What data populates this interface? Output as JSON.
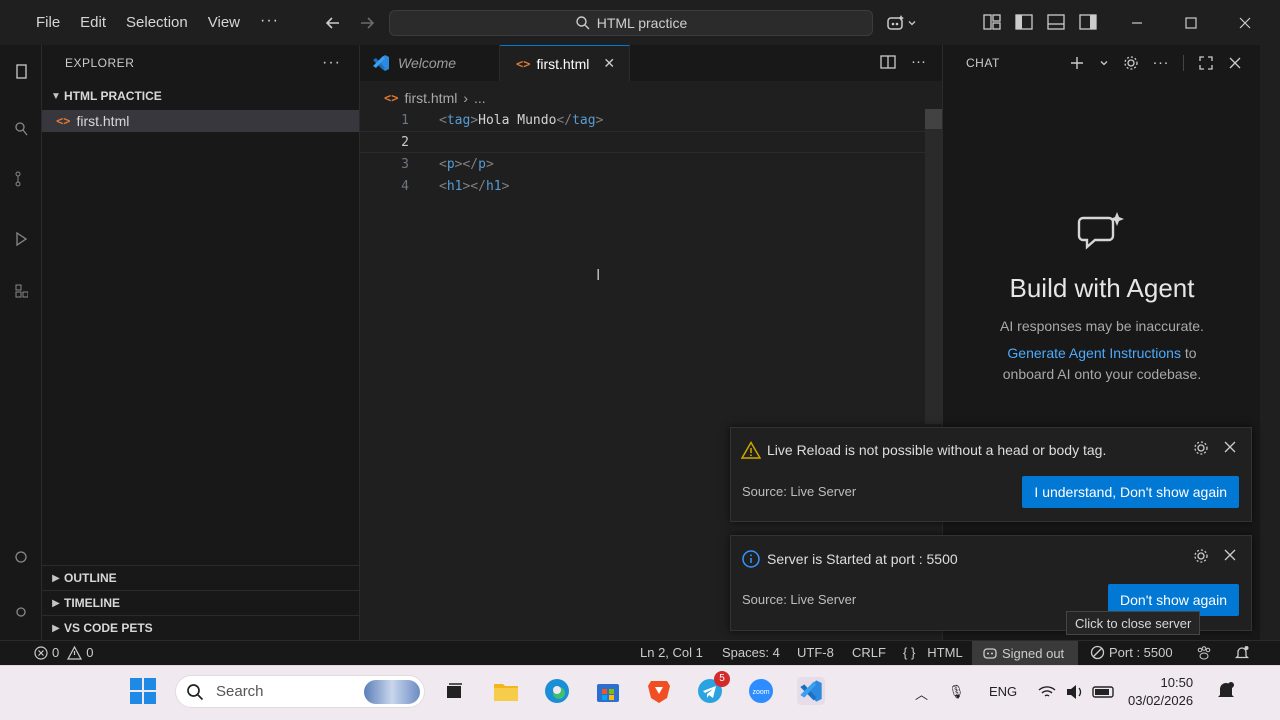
{
  "titlebar": {
    "menu": [
      "File",
      "Edit",
      "Selection",
      "View"
    ],
    "more": "···",
    "search": "HTML practice"
  },
  "sidebar": {
    "header": "EXPLORER",
    "more": "···",
    "folder": "HTML PRACTICE",
    "files": [
      {
        "name": "first.html",
        "icon": "html-file-icon"
      }
    ],
    "sections": [
      "OUTLINE",
      "TIMELINE",
      "VS CODE PETS"
    ]
  },
  "editor": {
    "tabs": [
      {
        "label": "Welcome",
        "icon": "vscode-icon",
        "active": false
      },
      {
        "label": "first.html",
        "icon": "html-file-icon",
        "active": true
      }
    ],
    "breadcrumb": {
      "file": "first.html",
      "rest": "..."
    },
    "line_numbers": [
      "1",
      "2",
      "3",
      "4"
    ],
    "current_line": "2",
    "lines": [
      [
        {
          "c": "p",
          "v": "<"
        },
        {
          "c": "t",
          "v": "tag"
        },
        {
          "c": "p",
          "v": ">"
        },
        {
          "c": "tx",
          "v": "Hola Mundo"
        },
        {
          "c": "p",
          "v": "</"
        },
        {
          "c": "t",
          "v": "tag"
        },
        {
          "c": "p",
          "v": ">"
        }
      ],
      [],
      [
        {
          "c": "p",
          "v": "<"
        },
        {
          "c": "t",
          "v": "p"
        },
        {
          "c": "p",
          "v": "></"
        },
        {
          "c": "t",
          "v": "p"
        },
        {
          "c": "p",
          "v": ">"
        }
      ],
      [
        {
          "c": "p",
          "v": "<"
        },
        {
          "c": "t",
          "v": "h1"
        },
        {
          "c": "p",
          "v": "></"
        },
        {
          "c": "t",
          "v": "h1"
        },
        {
          "c": "p",
          "v": ">"
        }
      ]
    ]
  },
  "chat": {
    "header": "CHAT",
    "title": "Build with Agent",
    "disclaimer": "AI responses may be inaccurate.",
    "link": "Generate Agent Instructions",
    "link_suffix": " to",
    "line2": "onboard AI onto your codebase."
  },
  "notifications": [
    {
      "message": "Live Reload is not possible without a head or body tag.",
      "source": "Source: Live Server",
      "button": "I understand, Don't show again",
      "icon": "warning-icon"
    },
    {
      "message": "Server is Started at port : 5500",
      "source": "Source: Live Server",
      "button": "Don't show again",
      "icon": "info-icon"
    }
  ],
  "tooltip": "Click to close server",
  "statusbar": {
    "errors": "0",
    "warnings": "0",
    "position": "Ln 2, Col 1",
    "spaces": "Spaces: 4",
    "encoding": "UTF-8",
    "eol": "CRLF",
    "language": "HTML",
    "account": "Signed out",
    "port": "Port : 5500"
  },
  "taskbar": {
    "search": "Search",
    "language": "ENG",
    "time": "10:50",
    "date": "03/02/2026",
    "telegram_badge": "5",
    "zoom_label": "zoom"
  },
  "colors": {
    "accent": "#0078d4",
    "link": "#4daafc",
    "warning": "#cca700",
    "tag": "#569cd6"
  }
}
